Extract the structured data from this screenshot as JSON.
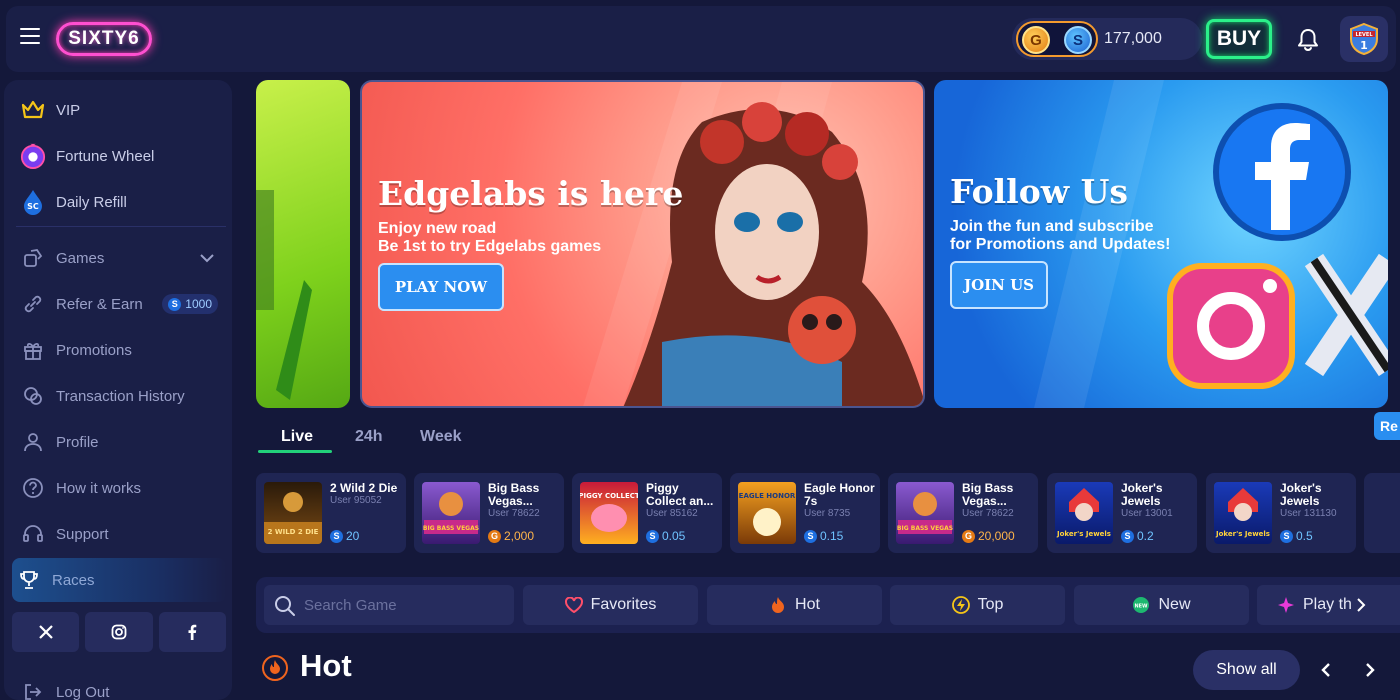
{
  "header": {
    "logo": "SIXTY6",
    "coin_gold": "G",
    "coin_sweep": "S",
    "balance": "177,000",
    "buy_label": "BUY",
    "level_label": "LEVEL",
    "level_value": "1"
  },
  "sidebar": {
    "top_items": [
      {
        "label": "VIP",
        "icon": "crown-icon"
      },
      {
        "label": "Fortune Wheel",
        "icon": "wheel-icon"
      },
      {
        "label": "Daily Refill",
        "icon": "refill-drop-icon"
      }
    ],
    "daily_refill_badge": "SC",
    "items": [
      {
        "label": "Games",
        "icon": "gamepad-icon"
      },
      {
        "label": "Refer & Earn",
        "icon": "link-icon"
      },
      {
        "label": "Promotions",
        "icon": "gift-icon"
      },
      {
        "label": "Transaction History",
        "icon": "history-icon"
      },
      {
        "label": "Profile",
        "icon": "user-icon"
      },
      {
        "label": "How it works",
        "icon": "question-icon"
      },
      {
        "label": "Support",
        "icon": "headset-icon"
      },
      {
        "label": "Races",
        "icon": "trophy-icon"
      }
    ],
    "refer_bonus": "1000",
    "refer_bonus_coin": "S",
    "logout_label": "Log Out",
    "social": [
      "x-icon",
      "instagram-icon",
      "facebook-icon"
    ]
  },
  "banners": {
    "edgelabs": {
      "title": "Edgelabs is here",
      "line1": "Enjoy new road",
      "line2": "Be 1st to try Edgelabs games",
      "button": "PLAY NOW"
    },
    "follow": {
      "title": "Follow Us",
      "line1": "Join the fun and subscribe",
      "line2": "for Promotions and Updates!",
      "button": "JOIN US"
    },
    "side_chip_1": "Re",
    "side_chip_2": "Re"
  },
  "time_tabs": [
    "Live",
    "24h",
    "Week"
  ],
  "winners": [
    {
      "title": "2 Wild 2 Die",
      "user": "User 95052",
      "amount": "20",
      "currency": "sc"
    },
    {
      "title": "Big Bass Vegas...",
      "user": "User 78622",
      "amount": "2,000",
      "currency": "gc"
    },
    {
      "title": "Piggy Collect an...",
      "user": "User 85162",
      "amount": "0.05",
      "currency": "sc"
    },
    {
      "title": "Eagle Honor 7s",
      "user": "User 8735",
      "amount": "0.15",
      "currency": "sc"
    },
    {
      "title": "Big Bass Vegas...",
      "user": "User 78622",
      "amount": "20,000",
      "currency": "gc"
    },
    {
      "title": "Joker's Jewels",
      "user": "User 13001",
      "amount": "0.2",
      "currency": "sc"
    },
    {
      "title": "Joker's Jewels",
      "user": "User 131130",
      "amount": "0.5",
      "currency": "sc"
    }
  ],
  "winner_coin_sc": "S",
  "winner_coin_gc": "G",
  "thumb_labels": {
    "wild": "2 WILD 2 DIE",
    "bass": "BIG BASS VEGAS",
    "piggy": "PIGGY COLLECT",
    "eagle": "EAGLE HONOR",
    "joker": "Joker's Jewels"
  },
  "filter": {
    "search_placeholder": "Search Game",
    "buttons": [
      "Favorites",
      "Hot",
      "Top",
      "New",
      "Play th"
    ],
    "new_badge": "NEW"
  },
  "hot_section": {
    "title": "Hot",
    "show_all": "Show all"
  },
  "colors": {
    "background": "#14183a",
    "panel": "#1a1f47",
    "accent_green": "#22d07a",
    "accent_pink": "#ff4fd0",
    "sweep_blue": "#1e6fe0",
    "gold": "#e47a14"
  }
}
